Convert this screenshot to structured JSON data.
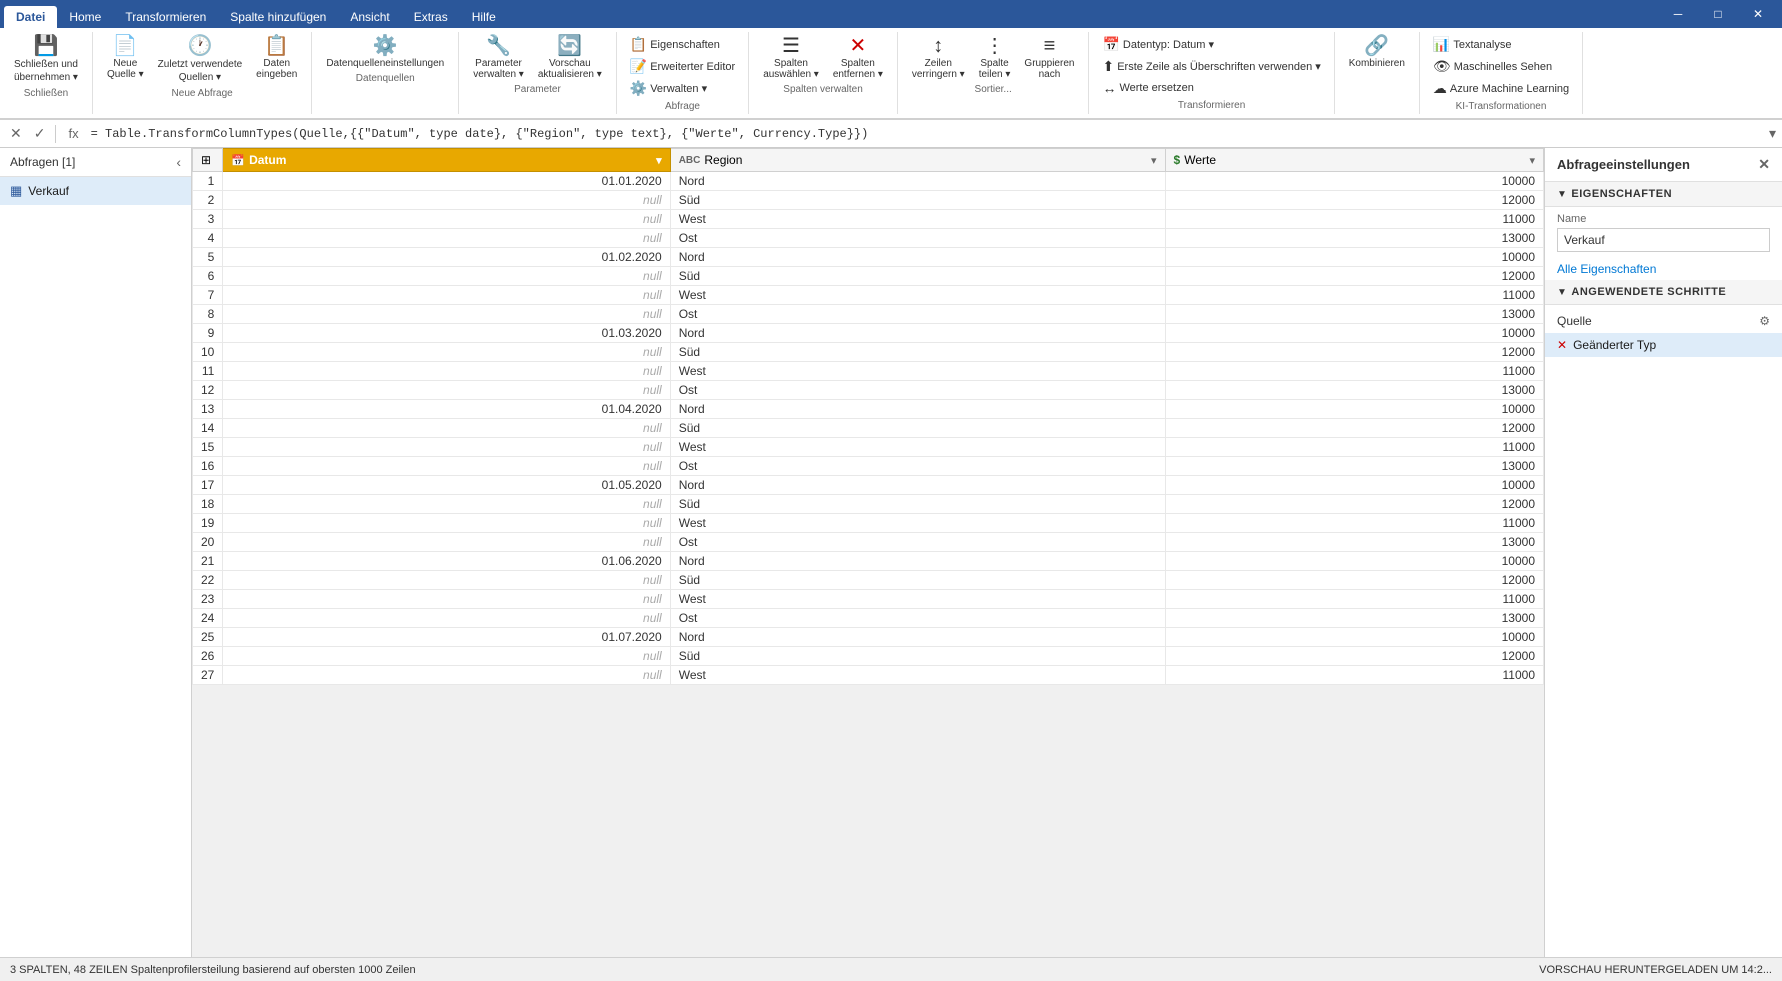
{
  "ribbon": {
    "tabs": [
      {
        "id": "datei",
        "label": "Datei",
        "active": true
      },
      {
        "id": "home",
        "label": "Home",
        "active": false
      },
      {
        "id": "transformieren",
        "label": "Transformieren",
        "active": false
      },
      {
        "id": "spalte-hinzufuegen",
        "label": "Spalte hinzufügen",
        "active": false
      },
      {
        "id": "ansicht",
        "label": "Ansicht",
        "active": false
      },
      {
        "id": "extras",
        "label": "Extras",
        "active": false
      },
      {
        "id": "hilfe",
        "label": "Hilfe",
        "active": false
      }
    ],
    "groups": {
      "schliessen": {
        "label": "Schließen",
        "buttons": [
          {
            "id": "schliessen-uebernehmen",
            "label": "Schließen und\nübernehmen",
            "icon": "💾",
            "has_dropdown": true
          }
        ]
      },
      "neue_abfrage": {
        "label": "Neue Abfrage",
        "buttons": [
          {
            "id": "neue-quelle",
            "label": "Neue\nQuelle",
            "icon": "📄",
            "has_dropdown": true
          },
          {
            "id": "zuletzt-verwendet",
            "label": "Zuletzt verwendete\nQuellen",
            "icon": "🕐",
            "has_dropdown": true
          },
          {
            "id": "daten-eingeben",
            "label": "Daten\neingeben",
            "icon": "📋"
          }
        ]
      },
      "datenquellen": {
        "label": "Datenquellen",
        "buttons": [
          {
            "id": "datenquelleneinstellungen",
            "label": "Datenquelleneinstellungen",
            "icon": "⚙️"
          }
        ]
      },
      "parameter": {
        "label": "Parameter",
        "buttons": [
          {
            "id": "parameter-verwalten",
            "label": "Parameter\nverwalten",
            "icon": "🔧",
            "has_dropdown": true
          },
          {
            "id": "vorschau-aktualisieren",
            "label": "Vorschau\naktualisieren",
            "icon": "🔄",
            "has_dropdown": true
          }
        ]
      },
      "abfrage": {
        "label": "Abfrage",
        "small_buttons": [
          {
            "id": "eigenschaften",
            "label": "Eigenschaften",
            "icon": "📋"
          },
          {
            "id": "erweiterter-editor",
            "label": "Erweiterter Editor",
            "icon": "📝"
          },
          {
            "id": "verwalten",
            "label": "Verwalten",
            "icon": "⚙️",
            "has_dropdown": true
          }
        ]
      },
      "spalten_verwalten": {
        "label": "Spalten verwalten",
        "buttons": [
          {
            "id": "spalten-auswaehlen",
            "label": "Spalten\nauswählen",
            "icon": "☰",
            "has_dropdown": true
          },
          {
            "id": "spalten-entfernen",
            "label": "Spalten\nentfernen",
            "icon": "✕",
            "has_dropdown": true
          }
        ]
      },
      "sortier": {
        "label": "Sortier...",
        "buttons": [
          {
            "id": "zeilen-verringern",
            "label": "Zeilen\nverringern",
            "icon": "↕",
            "has_dropdown": true
          },
          {
            "id": "spalte-teilen",
            "label": "Spalte\nteilen",
            "icon": "⋮",
            "has_dropdown": true
          },
          {
            "id": "gruppieren-nach",
            "label": "Gruppieren\nnach",
            "icon": "≡"
          }
        ]
      },
      "transformieren": {
        "label": "Transformieren",
        "small_buttons": [
          {
            "id": "datentyp",
            "label": "Datentyp: Datum",
            "icon": "📅",
            "has_dropdown": true
          },
          {
            "id": "erste-zeile",
            "label": "Erste Zeile als Überschriften verwenden",
            "icon": "⬆",
            "has_dropdown": true
          },
          {
            "id": "werte-ersetzen",
            "label": "Werte ersetzen",
            "icon": "↔"
          }
        ]
      },
      "kombinieren": {
        "label": "",
        "buttons": [
          {
            "id": "kombinieren-btn",
            "label": "Kombinieren",
            "icon": "🔗"
          }
        ]
      },
      "ki_transformationen": {
        "label": "KI-Transformationen",
        "small_buttons": [
          {
            "id": "textanalyse",
            "label": "Textanalyse",
            "icon": "📊"
          },
          {
            "id": "maschinelles-sehen",
            "label": "Maschinelles Sehen",
            "icon": "👁"
          },
          {
            "id": "azure-ml",
            "label": "Azure Machine Learning",
            "icon": "☁"
          }
        ]
      }
    }
  },
  "formula_bar": {
    "cancel_icon": "✕",
    "confirm_icon": "✓",
    "fx_label": "fx",
    "formula": "= Table.TransformColumnTypes(Quelle,{{\"Datum\", type date}, {\"Region\", type text}, {\"Werte\", Currency.Type}})"
  },
  "queries_panel": {
    "header": "Abfragen [1]",
    "items": [
      {
        "id": "verkauf",
        "label": "Verkauf",
        "icon": "▦"
      }
    ]
  },
  "grid": {
    "columns": [
      {
        "id": "datum",
        "label": "Datum",
        "type_icon": "📅",
        "type_label": "date",
        "active": true
      },
      {
        "id": "region",
        "label": "Region",
        "type_icon": "ABC",
        "type_label": "text",
        "active": false
      },
      {
        "id": "werte",
        "label": "Werte",
        "type_icon": "$",
        "type_label": "currency",
        "active": false
      }
    ],
    "rows": [
      {
        "num": 1,
        "datum": "01.01.2020",
        "region": "Nord",
        "werte": "10000"
      },
      {
        "num": 2,
        "datum": "null",
        "region": "Süd",
        "werte": "12000"
      },
      {
        "num": 3,
        "datum": "null",
        "region": "West",
        "werte": "11000"
      },
      {
        "num": 4,
        "datum": "null",
        "region": "Ost",
        "werte": "13000"
      },
      {
        "num": 5,
        "datum": "01.02.2020",
        "region": "Nord",
        "werte": "10000"
      },
      {
        "num": 6,
        "datum": "null",
        "region": "Süd",
        "werte": "12000"
      },
      {
        "num": 7,
        "datum": "null",
        "region": "West",
        "werte": "11000"
      },
      {
        "num": 8,
        "datum": "null",
        "region": "Ost",
        "werte": "13000"
      },
      {
        "num": 9,
        "datum": "01.03.2020",
        "region": "Nord",
        "werte": "10000"
      },
      {
        "num": 10,
        "datum": "null",
        "region": "Süd",
        "werte": "12000"
      },
      {
        "num": 11,
        "datum": "null",
        "region": "West",
        "werte": "11000"
      },
      {
        "num": 12,
        "datum": "null",
        "region": "Ost",
        "werte": "13000"
      },
      {
        "num": 13,
        "datum": "01.04.2020",
        "region": "Nord",
        "werte": "10000"
      },
      {
        "num": 14,
        "datum": "null",
        "region": "Süd",
        "werte": "12000"
      },
      {
        "num": 15,
        "datum": "null",
        "region": "West",
        "werte": "11000"
      },
      {
        "num": 16,
        "datum": "null",
        "region": "Ost",
        "werte": "13000"
      },
      {
        "num": 17,
        "datum": "01.05.2020",
        "region": "Nord",
        "werte": "10000"
      },
      {
        "num": 18,
        "datum": "null",
        "region": "Süd",
        "werte": "12000"
      },
      {
        "num": 19,
        "datum": "null",
        "region": "West",
        "werte": "11000"
      },
      {
        "num": 20,
        "datum": "null",
        "region": "Ost",
        "werte": "13000"
      },
      {
        "num": 21,
        "datum": "01.06.2020",
        "region": "Nord",
        "werte": "10000"
      },
      {
        "num": 22,
        "datum": "null",
        "region": "Süd",
        "werte": "12000"
      },
      {
        "num": 23,
        "datum": "null",
        "region": "West",
        "werte": "11000"
      },
      {
        "num": 24,
        "datum": "null",
        "region": "Ost",
        "werte": "13000"
      },
      {
        "num": 25,
        "datum": "01.07.2020",
        "region": "Nord",
        "werte": "10000"
      },
      {
        "num": 26,
        "datum": "null",
        "region": "Süd",
        "werte": "12000"
      },
      {
        "num": 27,
        "datum": "null",
        "region": "West",
        "werte": "11000"
      }
    ]
  },
  "properties_panel": {
    "title": "Abfrageeinstellungen",
    "close_icon": "✕",
    "sections": {
      "eigenschaften": {
        "label": "EIGENSCHAFTEN",
        "name_label": "Name",
        "name_value": "Verkauf",
        "all_properties_link": "Alle Eigenschaften"
      },
      "angewendete_schritte": {
        "label": "ANGEWENDETE SCHRITTE",
        "steps": [
          {
            "id": "quelle",
            "label": "Quelle",
            "has_gear": true,
            "active": false
          },
          {
            "id": "geaenderter-typ",
            "label": "Geänderter Typ",
            "has_delete": true,
            "active": true
          }
        ]
      }
    }
  },
  "status_bar": {
    "left": "3 SPALTEN, 48 ZEILEN   Spaltenprofilersteilung basierend auf obersten 1000 Zeilen",
    "right": "VORSCHAU HERUNTERGELADEN UM 14:2..."
  }
}
